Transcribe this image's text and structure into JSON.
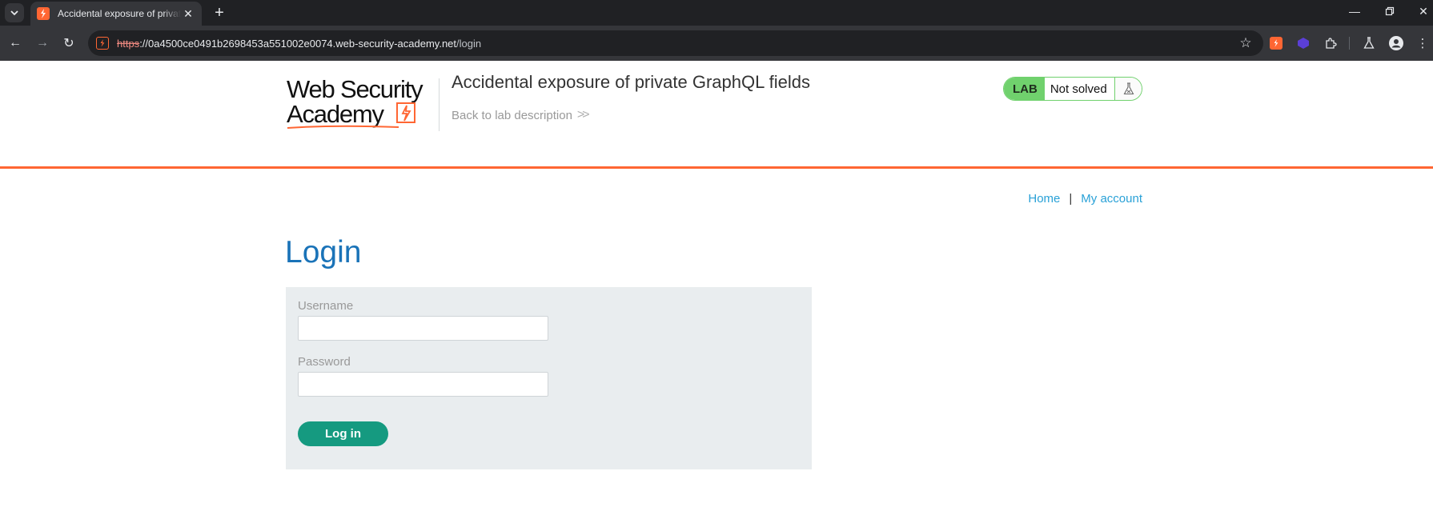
{
  "browser": {
    "tab_title": "Accidental exposure of private GraphQL fields",
    "url_scheme": "https",
    "url_host": "://0a4500ce0491b2698453a551002e0074.web-security-academy.net",
    "url_path": "/login",
    "icons": {
      "tab_search": "chevron-down-icon",
      "favicon": "portswigger-icon",
      "close": "close-icon",
      "new_tab": "plus-icon",
      "minimize": "minimize-icon",
      "restore": "restore-icon",
      "window_close": "close-icon",
      "back": "arrow-left-icon",
      "forward": "arrow-right-icon",
      "reload": "reload-icon",
      "bookmark": "star-icon",
      "extensions": [
        "burp-extension-icon",
        "cube-extension-icon",
        "puzzle-icon",
        "flask-icon",
        "profile-icon",
        "kebab-menu-icon"
      ]
    }
  },
  "header": {
    "logo_line1": "Web Security",
    "logo_line2": "Academy",
    "lab_title": "Accidental exposure of private GraphQL fields",
    "back_link": "Back to lab description",
    "lab_badge": "LAB",
    "lab_status": "Not solved"
  },
  "nav": {
    "home": "Home",
    "separator": "|",
    "my_account": "My account"
  },
  "main": {
    "heading": "Login",
    "username_label": "Username",
    "username_value": "",
    "password_label": "Password",
    "password_value": "",
    "login_button": "Log in"
  },
  "colors": {
    "accent_orange": "#ff6633",
    "heading_blue": "#1a73b8",
    "link_blue": "#29a1d7",
    "lab_green": "#70d16d",
    "button_teal": "#159a80",
    "panel_gray": "#e9edef"
  }
}
